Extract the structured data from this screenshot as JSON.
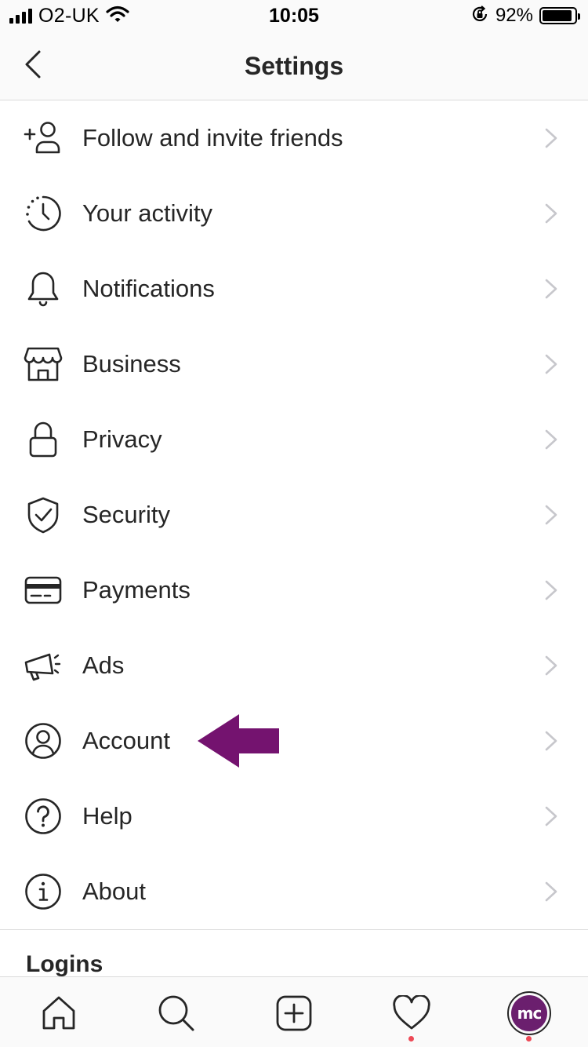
{
  "status_bar": {
    "carrier": "O2-UK",
    "time": "10:05",
    "battery_percent": "92%",
    "battery_level": 0.92
  },
  "header": {
    "title": "Settings",
    "back_icon": "chevron-left-icon"
  },
  "menu": {
    "items": [
      {
        "label": "Follow and invite friends",
        "icon": "add-person-icon"
      },
      {
        "label": "Your activity",
        "icon": "activity-clock-icon"
      },
      {
        "label": "Notifications",
        "icon": "bell-icon"
      },
      {
        "label": "Business",
        "icon": "storefront-icon"
      },
      {
        "label": "Privacy",
        "icon": "lock-icon"
      },
      {
        "label": "Security",
        "icon": "shield-check-icon"
      },
      {
        "label": "Payments",
        "icon": "card-icon"
      },
      {
        "label": "Ads",
        "icon": "megaphone-icon"
      },
      {
        "label": "Account",
        "icon": "person-circle-icon"
      },
      {
        "label": "Help",
        "icon": "question-circle-icon"
      },
      {
        "label": "About",
        "icon": "info-circle-icon"
      }
    ]
  },
  "section": {
    "logins_heading": "Logins"
  },
  "annotation": {
    "arrow_color": "#74136f",
    "target": "Account"
  },
  "tab_bar": {
    "tabs": [
      {
        "icon": "home-icon",
        "notification_dot": false
      },
      {
        "icon": "search-icon",
        "notification_dot": false
      },
      {
        "icon": "new-post-icon",
        "notification_dot": false
      },
      {
        "icon": "heart-icon",
        "notification_dot": true
      },
      {
        "icon": "profile-avatar",
        "notification_dot": true
      }
    ],
    "avatar_text": "mc",
    "avatar_color": "#6b1f6e",
    "dot_color": "#ed4956"
  }
}
